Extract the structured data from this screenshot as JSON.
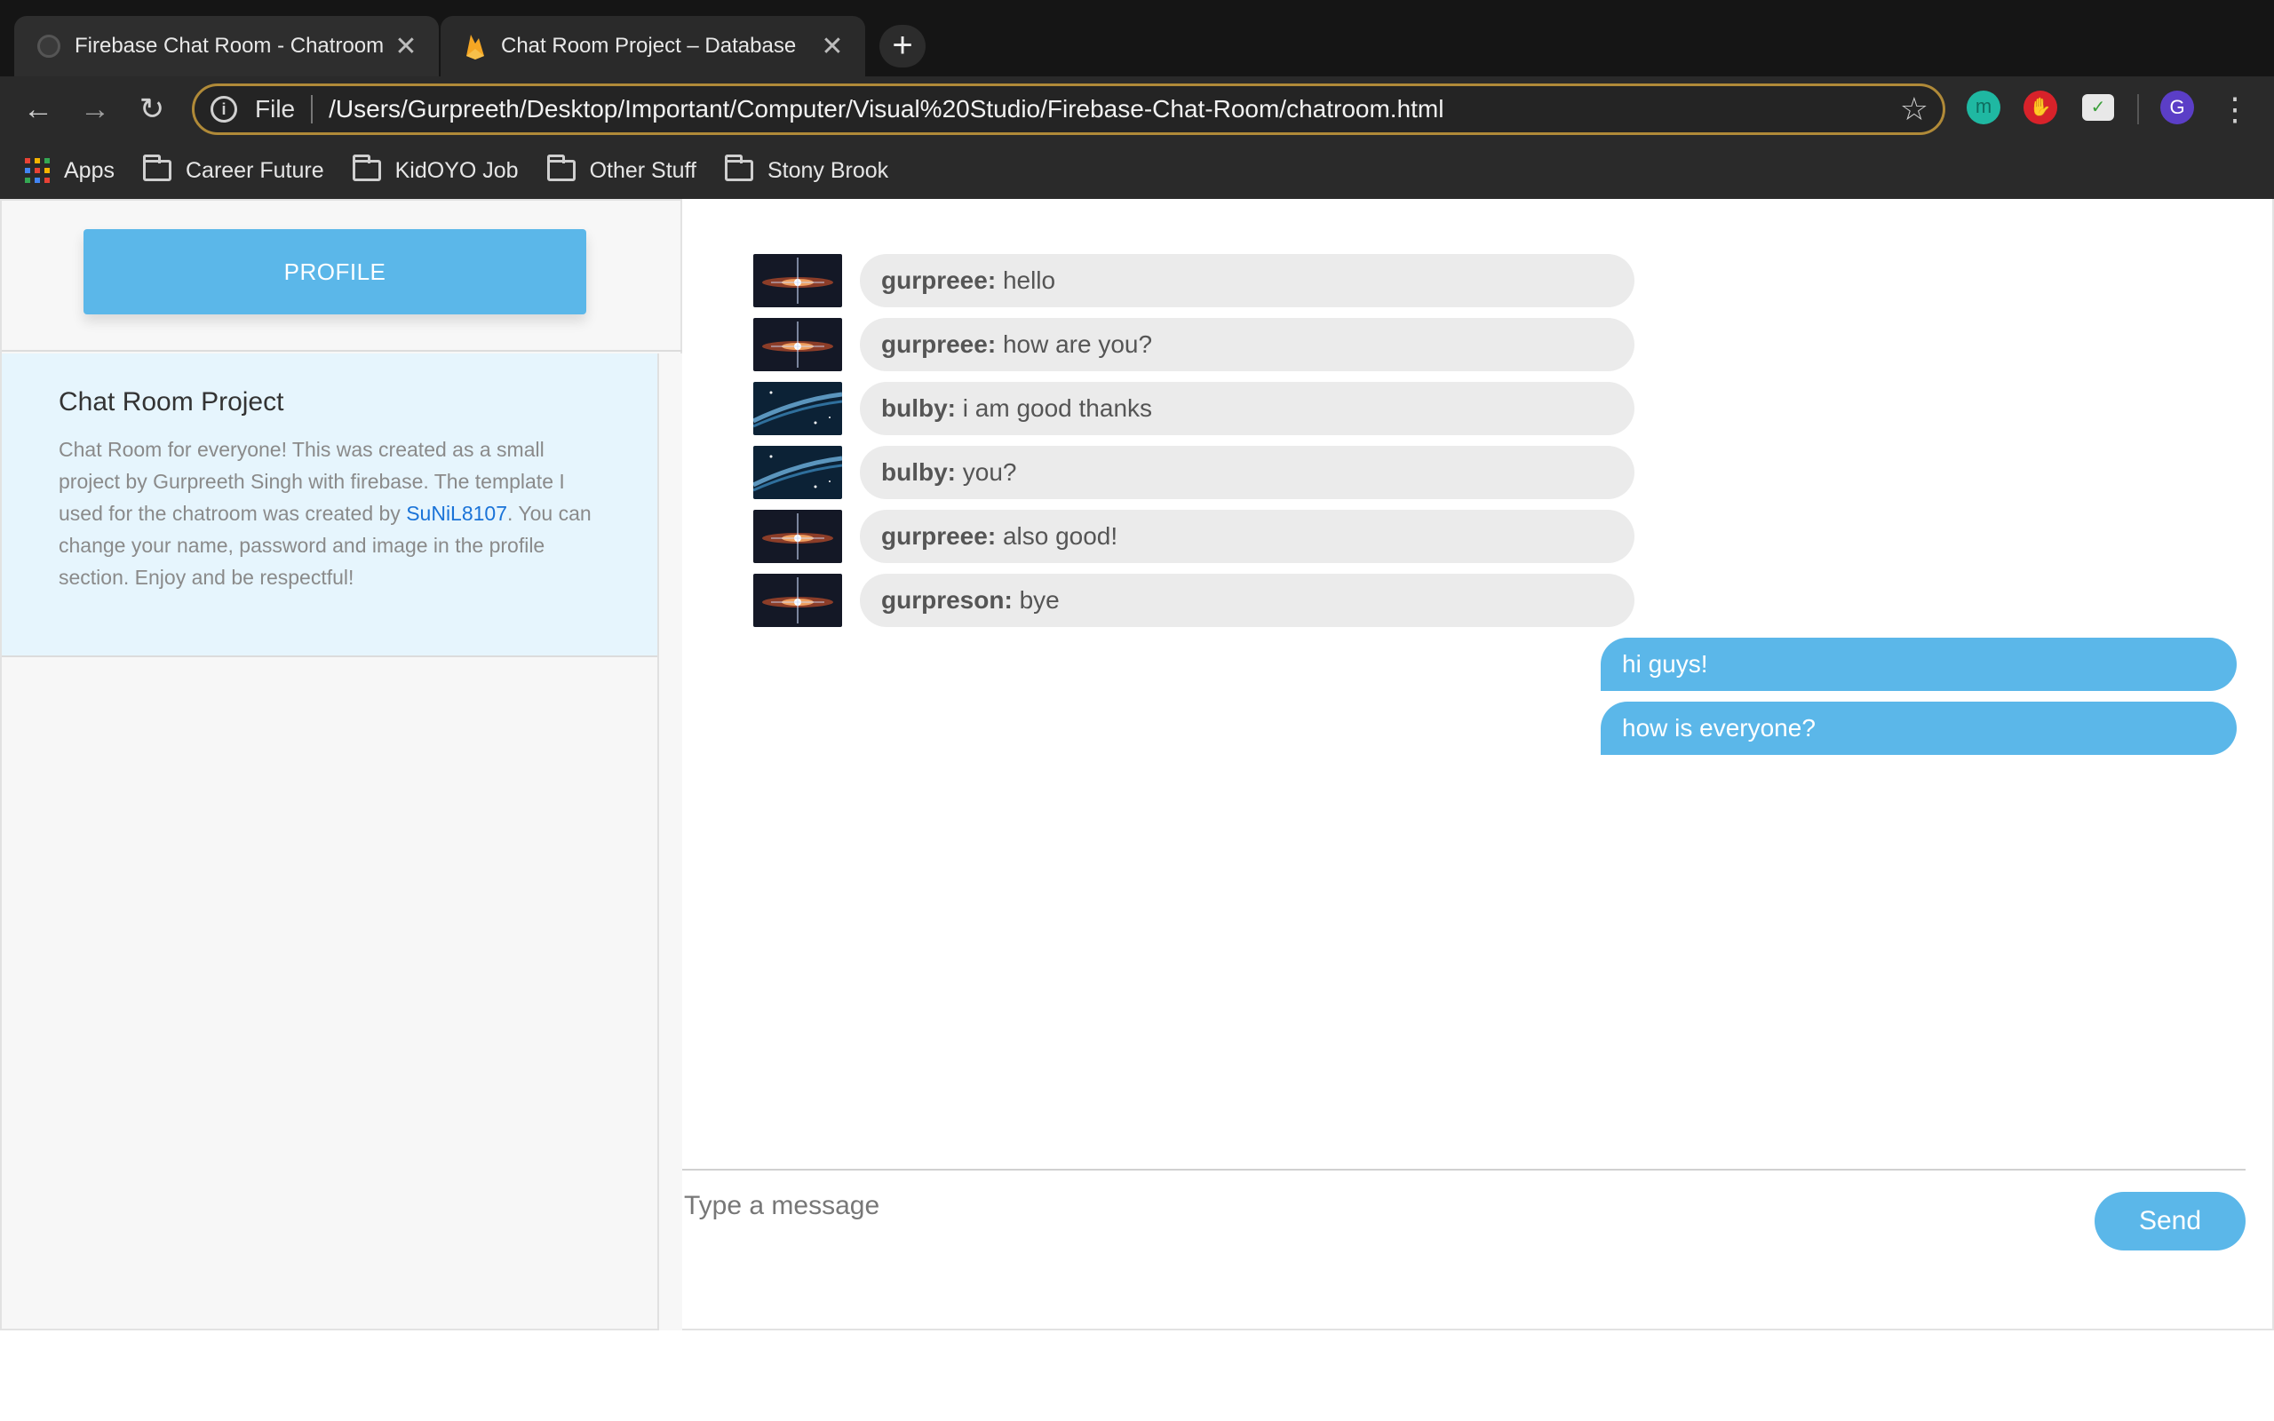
{
  "browser": {
    "tabs": [
      {
        "title": "Firebase Chat Room - Chatroom",
        "close": "✕"
      },
      {
        "title": "Chat Room Project – Database",
        "close": "✕"
      }
    ],
    "new_tab": "+",
    "omnibox": {
      "scheme": "File",
      "url": "/Users/Gurpreeth/Desktop/Important/Computer/Visual%20Studio/Firebase-Chat-Room/chatroom.html"
    },
    "extensions": {
      "profile_initial": "G"
    },
    "bookmarks": [
      {
        "label": "Apps",
        "icon": "apps-grid-icon"
      },
      {
        "label": "Career Future",
        "icon": "folder-icon"
      },
      {
        "label": "KidOYO Job",
        "icon": "folder-icon"
      },
      {
        "label": "Other Stuff",
        "icon": "folder-icon"
      },
      {
        "label": "Stony Brook",
        "icon": "folder-icon"
      }
    ]
  },
  "sidebar": {
    "profile_button": "PROFILE",
    "room": {
      "title": "Chat Room Project",
      "description_before": "Chat Room for everyone! This was created as a small project by Gurpreeth Singh with firebase. The template I used for the chatroom was created by ",
      "link_text": "SuNiL8107",
      "description_after": ". You can change your name, password and image in the profile section. Enjoy and be respectful!"
    }
  },
  "chat": {
    "incoming": [
      {
        "user": "gurpreee:",
        "text": "hello",
        "avatar": "galaxy-avatar"
      },
      {
        "user": "gurpreee:",
        "text": "how are you?",
        "avatar": "galaxy-avatar"
      },
      {
        "user": "bulby:",
        "text": "i am good thanks",
        "avatar": "space-blue-avatar"
      },
      {
        "user": "bulby:",
        "text": "you?",
        "avatar": "space-blue-avatar"
      },
      {
        "user": "gurpreee:",
        "text": "also good!",
        "avatar": "galaxy-avatar"
      },
      {
        "user": "gurpreson:",
        "text": "bye",
        "avatar": "galaxy-avatar"
      }
    ],
    "outgoing": [
      {
        "text": "hi guys!"
      },
      {
        "text": "how is everyone?"
      }
    ],
    "compose": {
      "placeholder": "Type a message",
      "send_label": "Send"
    }
  },
  "colors": {
    "accent": "#5bb7e9",
    "incoming_bubble": "#ebebeb",
    "room_card": "#e6f5fd",
    "link": "#1a73d8"
  }
}
